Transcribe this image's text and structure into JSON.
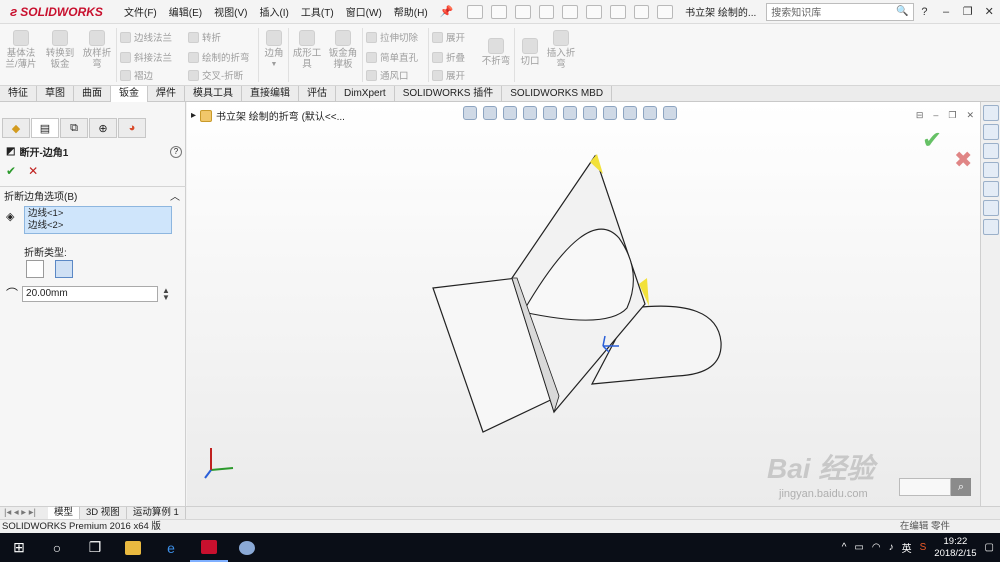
{
  "app": {
    "brand": "SOLIDWORKS",
    "doc_title": "书立架 绘制的...",
    "search_placeholder": "搜索知识库"
  },
  "menu": [
    "文件(F)",
    "编辑(E)",
    "视图(V)",
    "插入(I)",
    "工具(T)",
    "窗口(W)",
    "帮助(H)"
  ],
  "ribbon": {
    "base_flange": "基体法\n兰/薄片",
    "convert_to_sheet": "转换到\n钣金",
    "lofted_bend": "放样折\n弯",
    "edge_flange": "边线法兰",
    "miter_flange": "斜接法兰",
    "hem": "褶边",
    "jog": "转折",
    "sketched_bend": "绘制的折弯",
    "cross_break": "交叉-折断",
    "corners": "边角",
    "forming_tool": "成形工\n具",
    "sheet_gusset": "钣金角\n撑板",
    "extruded_cut": "拉伸切除",
    "simple_hole": "简单直孔",
    "vent": "通风口",
    "unfold": "展开",
    "fold": "折叠",
    "flatten": "展开",
    "no_bends": "不折弯",
    "rip": "切口",
    "insert_bends": "插入折\n弯"
  },
  "tabs": [
    "特征",
    "草图",
    "曲面",
    "钣金",
    "焊件",
    "模具工具",
    "直接编辑",
    "评估",
    "DimXpert",
    "SOLIDWORKS 插件",
    "SOLIDWORKS MBD"
  ],
  "active_tab": "钣金",
  "property_manager": {
    "title": "断开-边角1",
    "section_title": "折断边角选项(B)",
    "edges": [
      "边线<1>",
      "边线<2>"
    ],
    "break_type_label": "折断类型:",
    "distance": "20.00mm"
  },
  "graphics": {
    "breadcrumb": "书立架 绘制的折弯 (默认<<..."
  },
  "watermark": {
    "text": "Bai 经验",
    "url": "jingyan.baidu.com"
  },
  "bottom_tabs": [
    "模型",
    "3D 视图",
    "运动算例 1"
  ],
  "active_bottom_tab": "模型",
  "status": {
    "text": "SOLIDWORKS Premium 2016 x64 版",
    "right": "在编辑 零件"
  },
  "taskbar": {
    "ime": "英",
    "time": "19:22",
    "date": "2018/2/15"
  },
  "colors": {
    "brand_red": "#c8102e",
    "ok_green": "#2c9a2c",
    "cancel_red": "#c0211f",
    "selection_blue": "#cfe5fb",
    "highlight_yellow": "#f2e13a"
  }
}
